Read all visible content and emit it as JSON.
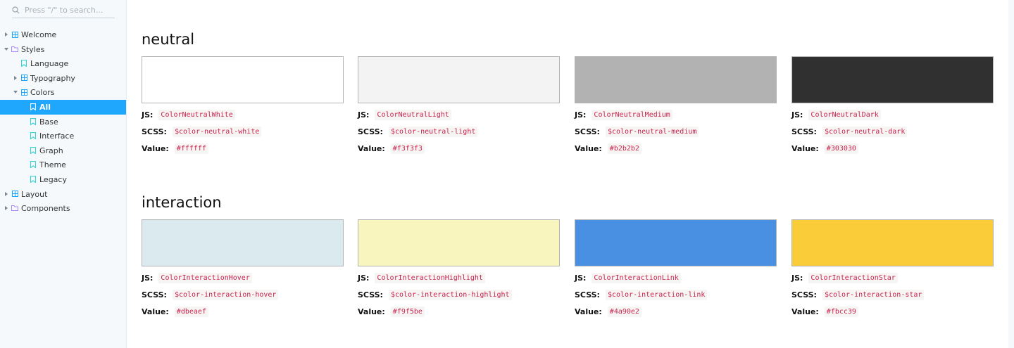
{
  "search": {
    "placeholder": "Press \"/\" to search..."
  },
  "sidebar": {
    "items": [
      {
        "label": "Welcome",
        "kind": "component",
        "caret": "right"
      },
      {
        "label": "Styles",
        "kind": "folder",
        "caret": "down"
      },
      {
        "label": "Language",
        "kind": "story",
        "caret": ""
      },
      {
        "label": "Typography",
        "kind": "component",
        "caret": "right"
      },
      {
        "label": "Colors",
        "kind": "component",
        "caret": "down"
      },
      {
        "label": "All",
        "kind": "story",
        "caret": "",
        "selected": true
      },
      {
        "label": "Base",
        "kind": "story",
        "caret": ""
      },
      {
        "label": "Interface",
        "kind": "story",
        "caret": ""
      },
      {
        "label": "Graph",
        "kind": "story",
        "caret": ""
      },
      {
        "label": "Theme",
        "kind": "story",
        "caret": ""
      },
      {
        "label": "Legacy",
        "kind": "story",
        "caret": ""
      },
      {
        "label": "Layout",
        "kind": "component",
        "caret": "right"
      },
      {
        "label": "Components",
        "kind": "folder",
        "caret": "right"
      }
    ]
  },
  "labels": {
    "js": "JS:",
    "scss": "SCSS:",
    "value": "Value:"
  },
  "sections": [
    {
      "title": "neutral",
      "colors": [
        {
          "js": "ColorNeutralWhite",
          "scss": "$color-neutral-white",
          "value": "#ffffff"
        },
        {
          "js": "ColorNeutralLight",
          "scss": "$color-neutral-light",
          "value": "#f3f3f3"
        },
        {
          "js": "ColorNeutralMedium",
          "scss": "$color-neutral-medium",
          "value": "#b2b2b2"
        },
        {
          "js": "ColorNeutralDark",
          "scss": "$color-neutral-dark",
          "value": "#303030"
        }
      ]
    },
    {
      "title": "interaction",
      "colors": [
        {
          "js": "ColorInteractionHover",
          "scss": "$color-interaction-hover",
          "value": "#dbeaef"
        },
        {
          "js": "ColorInteractionHighlight",
          "scss": "$color-interaction-highlight",
          "value": "#f9f5be"
        },
        {
          "js": "ColorInteractionLink",
          "scss": "$color-interaction-link",
          "value": "#4a90e2"
        },
        {
          "js": "ColorInteractionStar",
          "scss": "$color-interaction-star",
          "value": "#fbcc39"
        }
      ]
    }
  ],
  "colors": {
    "accent": "#1ea7fd",
    "code_text": "#c7254e"
  }
}
